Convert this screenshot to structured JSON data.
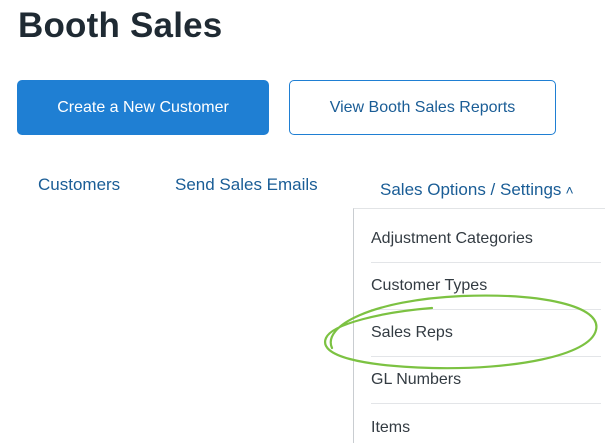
{
  "page": {
    "title": "Booth Sales"
  },
  "actions": {
    "create_customer": "Create a New Customer",
    "view_reports": "View Booth Sales Reports"
  },
  "nav": {
    "customers": "Customers",
    "send_emails": "Send Sales Emails",
    "settings": "Sales Options / Settings",
    "settings_icon": "chevron-up-icon"
  },
  "dropdown": {
    "items": [
      {
        "label": "Adjustment Categories"
      },
      {
        "label": "Customer Types"
      },
      {
        "label": "Sales Reps"
      },
      {
        "label": "GL Numbers"
      },
      {
        "label": "Items"
      }
    ]
  },
  "annotation": {
    "highlight_target": "Sales Reps",
    "highlight_color": "#7cc242"
  },
  "colors": {
    "primary": "#1f7fd3",
    "link": "#1a5d96",
    "heading": "#1f2a33"
  }
}
